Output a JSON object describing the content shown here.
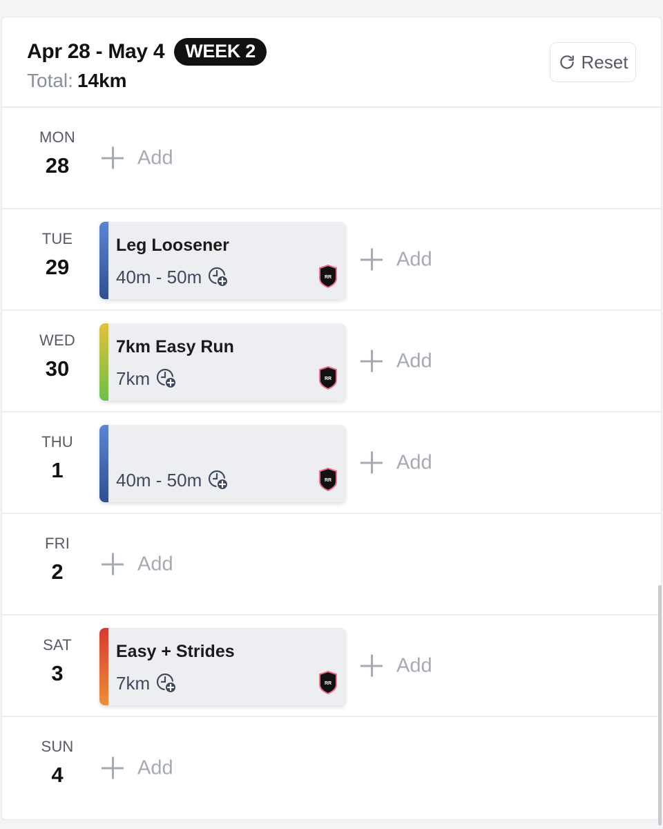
{
  "header": {
    "date_range": "Apr 28 - May 4",
    "week_badge": "WEEK 2",
    "total_label": "Total:",
    "total_value": "14km",
    "reset_label": "Reset",
    "reset_icon": "refresh-icon"
  },
  "add_label": "Add",
  "days": [
    {
      "dow": "MON",
      "num": "28"
    },
    {
      "dow": "TUE",
      "num": "29",
      "workout": {
        "title": "Leg Loosener",
        "duration": "40m - 50m",
        "stripe": [
          "#5b86d6",
          "#2f4f8f"
        ],
        "badge": "RR"
      }
    },
    {
      "dow": "WED",
      "num": "30",
      "workout": {
        "title": "7km Easy Run",
        "duration": "7km",
        "stripe": [
          "#e3c13a",
          "#6cc04a"
        ],
        "badge": "RR"
      }
    },
    {
      "dow": "THU",
      "num": "1",
      "workout": {
        "title": "",
        "duration": "40m - 50m",
        "stripe": [
          "#5b86d6",
          "#2f4f8f"
        ],
        "badge": "RR"
      }
    },
    {
      "dow": "FRI",
      "num": "2"
    },
    {
      "dow": "SAT",
      "num": "3",
      "workout": {
        "title": "Easy + Strides",
        "duration": "7km",
        "stripe": [
          "#d83a2f",
          "#ec8e3a"
        ],
        "badge": "RR"
      }
    },
    {
      "dow": "SUN",
      "num": "4"
    }
  ]
}
